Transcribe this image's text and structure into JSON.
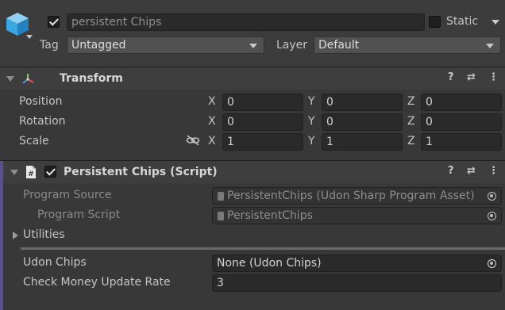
{
  "gameobject": {
    "name": "persistent Chips",
    "active": true,
    "static_label": "Static",
    "static_checked": false,
    "tag_label": "Tag",
    "tag_value": "Untagged",
    "layer_label": "Layer",
    "layer_value": "Default"
  },
  "transform": {
    "title": "Transform",
    "rows": [
      {
        "label": "Position",
        "x": "0",
        "y": "0",
        "z": "0"
      },
      {
        "label": "Rotation",
        "x": "0",
        "y": "0",
        "z": "0"
      },
      {
        "label": "Scale",
        "x": "1",
        "y": "1",
        "z": "1"
      }
    ],
    "axis_x": "X",
    "axis_y": "Y",
    "axis_z": "Z"
  },
  "script_component": {
    "title": "Persistent Chips (Script)",
    "enabled": true,
    "program_source_label": "Program Source",
    "program_source_value": "PersistentChips (Udon Sharp Program Asset)",
    "program_script_label": "Program Script",
    "program_script_value": "PersistentChips",
    "utilities_label": "Utilities",
    "udon_chips_label": "Udon Chips",
    "udon_chips_value": "None (Udon Chips)",
    "check_rate_label": "Check Money Update Rate",
    "check_rate_value": "3"
  },
  "colors": {
    "background": "#383838",
    "field": "#2a2a2a",
    "accent_bar": "#5b4e91"
  }
}
